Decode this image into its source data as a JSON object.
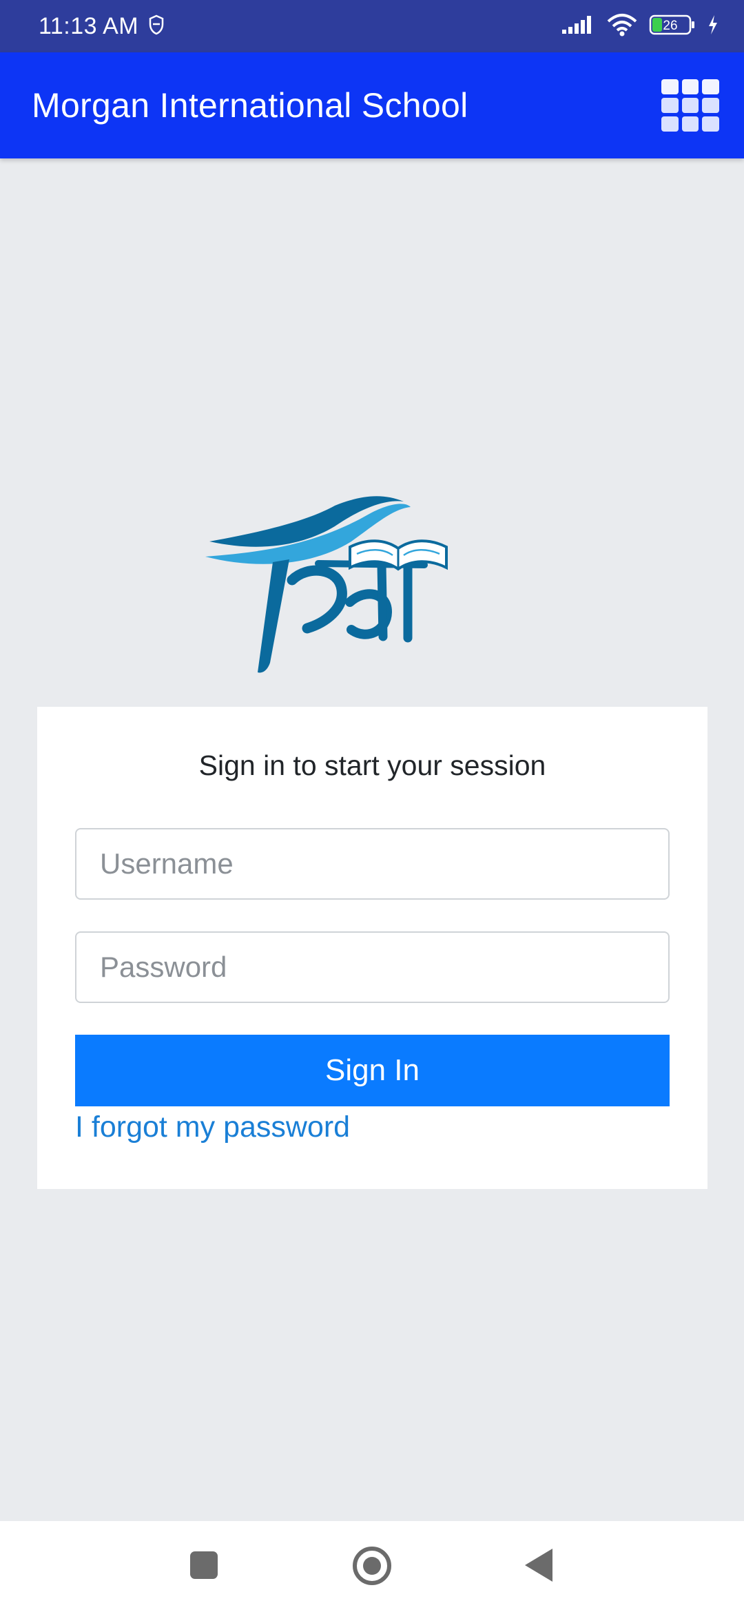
{
  "status_bar": {
    "time": "11:13 AM",
    "battery_level": "26",
    "icons": [
      "shield-icon",
      "signal-icon",
      "wifi-icon",
      "battery-icon",
      "charging-icon"
    ]
  },
  "app_bar": {
    "title": "Morgan International School",
    "menu_icon": "grid-menu-icon"
  },
  "logo": {
    "icon": "shiksha-logo-icon",
    "colors": {
      "dark": "#0b6a9d",
      "light": "#33a6dc"
    }
  },
  "login": {
    "message": "Sign in to start your session",
    "username": {
      "value": "",
      "placeholder": "Username"
    },
    "password": {
      "value": "",
      "placeholder": "Password"
    },
    "signin_label": "Sign In",
    "forgot_label": "I forgot my password"
  },
  "nav_bar": {
    "icons": [
      "recents-icon",
      "home-icon",
      "back-icon"
    ]
  },
  "colors": {
    "status_bar": "#2e3d9c",
    "app_bar": "#0d35f5",
    "background": "#e9ebee",
    "primary_button": "#0a7bff",
    "link": "#1a7fd6"
  }
}
